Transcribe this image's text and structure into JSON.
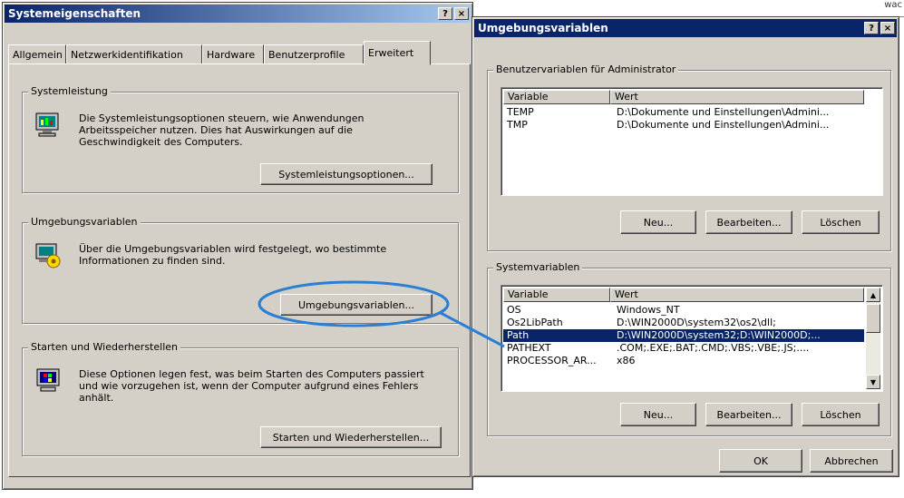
{
  "dialog_left": {
    "title": "Systemeigenschaften",
    "help_btn": "?",
    "close_btn": "×",
    "tabs": [
      "Allgemein",
      "Netzwerkidentifikation",
      "Hardware",
      "Benutzerprofile",
      "Erweitert"
    ],
    "active_tab": "Erweitert",
    "groups": {
      "performance": {
        "label": "Systemleistung",
        "description": "Die Systemleistungsoptionen steuern, wie Anwendungen Arbeitsspeicher nutzen. Dies hat Auswirkungen auf die Geschwindigkeit des Computers.",
        "button": "Systemleistungsoptionen..."
      },
      "environment": {
        "label": "Umgebungsvariablen",
        "description": "Über die Umgebungsvariablen wird festgelegt, wo bestimmte Informationen zu finden sind.",
        "button": "Umgebungsvariablen..."
      },
      "startup": {
        "label": "Starten und Wiederherstellen",
        "description": "Diese Optionen legen fest, was beim Starten des Computers passiert und wie vorzugehen ist, wenn der Computer aufgrund eines Fehlers anhält.",
        "button": "Starten und Wiederherstellen..."
      }
    }
  },
  "dialog_right": {
    "title": "Umgebungsvariablen",
    "help_btn": "?",
    "close_btn": "×",
    "user_vars": {
      "label": "Benutzervariablen für Administrator",
      "columns": [
        "Variable",
        "Wert"
      ],
      "rows": [
        {
          "variable": "TEMP",
          "value": "D:\\Dokumente und Einstellungen\\Admini..."
        },
        {
          "variable": "TMP",
          "value": "D:\\Dokumente und Einstellungen\\Admini..."
        }
      ],
      "buttons": {
        "new": "Neu...",
        "edit": "Bearbeiten...",
        "delete": "Löschen"
      }
    },
    "system_vars": {
      "label": "Systemvariablen",
      "columns": [
        "Variable",
        "Wert"
      ],
      "rows": [
        {
          "variable": "OS",
          "value": "Windows_NT"
        },
        {
          "variable": "Os2LibPath",
          "value": "D:\\WIN2000D\\system32\\os2\\dll;"
        },
        {
          "variable": "Path",
          "value": "D:\\WIN2000D\\system32;D:\\WIN2000D;..."
        },
        {
          "variable": "PATHEXT",
          "value": ".COM;.EXE;.BAT;.CMD;.VBS;.VBE;.JS;...."
        },
        {
          "variable": "PROCESSOR_AR...",
          "value": "x86"
        }
      ],
      "selected_row": "Path",
      "buttons": {
        "new": "Neu...",
        "edit": "Bearbeiten...",
        "delete": "Löschen"
      }
    },
    "ok": "OK",
    "cancel": "Abbrechen"
  },
  "background_snippet": "wac",
  "colors": {
    "title_gradient_start": "#0a246a",
    "title_gradient_end": "#a6caf0",
    "face": "#d4d0c8",
    "selection": "#0a246a",
    "callout": "#2a7fd4"
  }
}
